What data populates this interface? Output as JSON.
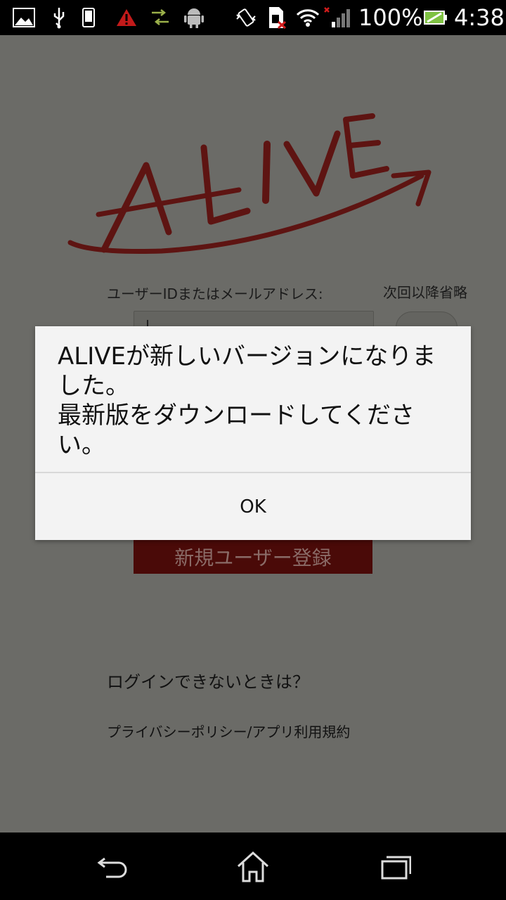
{
  "status_bar": {
    "battery_percent": "100%",
    "time": "4:38",
    "icons": [
      "image-icon",
      "usb-icon",
      "phone-icon",
      "warning-icon",
      "transfer-icon",
      "android-icon",
      "vibrate-icon",
      "sim-error-icon",
      "wifi-icon",
      "signal-icon",
      "battery-icon"
    ]
  },
  "app": {
    "logo_text": "ALIVE",
    "id_label": "ユーザーIDまたはメールアドレス:",
    "skip_label": "次回以降省略",
    "register_label": "新規ユーザー登録",
    "forgot_link": "ログインできないときは？",
    "policy_link": "プライバシーポリシー/アプリ利用規約",
    "brand_color": "#7a1412"
  },
  "dialog": {
    "message": "ALIVEが新しいバージョンになりました。\n最新版をダウンロードしてください。",
    "ok_label": "OK"
  },
  "nav_bar": {
    "icons": [
      "back-icon",
      "home-icon",
      "recent-apps-icon"
    ]
  }
}
